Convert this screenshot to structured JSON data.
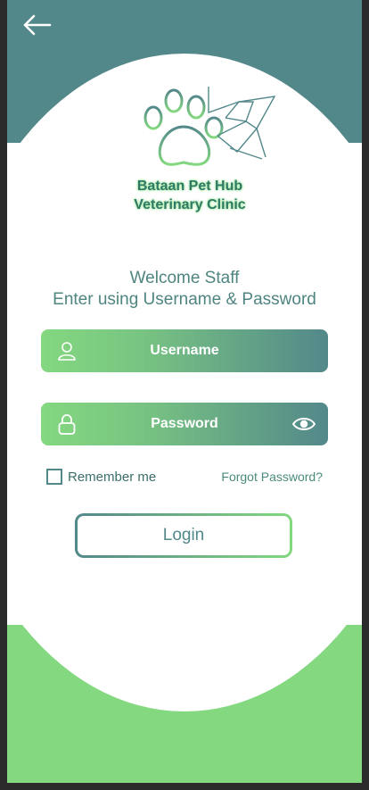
{
  "header": {
    "back_icon": "arrow-left-icon"
  },
  "brand": {
    "logo_icon": "paw-stethoscope-logo",
    "name_line1": "Bataan Pet Hub",
    "name_line2": "Veterinary Clinic"
  },
  "intro": {
    "line1": "Welcome Staff",
    "line2": "Enter using Username & Password"
  },
  "form": {
    "username": {
      "placeholder": "Username",
      "icon": "user-icon"
    },
    "password": {
      "placeholder": "Password",
      "icon": "lock-icon",
      "toggle_icon": "eye-icon"
    },
    "remember_label": "Remember me",
    "forgot_label": "Forgot Password?",
    "login_label": "Login"
  },
  "colors": {
    "teal": "#53888a",
    "green": "#84d880",
    "white": "#ffffff"
  }
}
